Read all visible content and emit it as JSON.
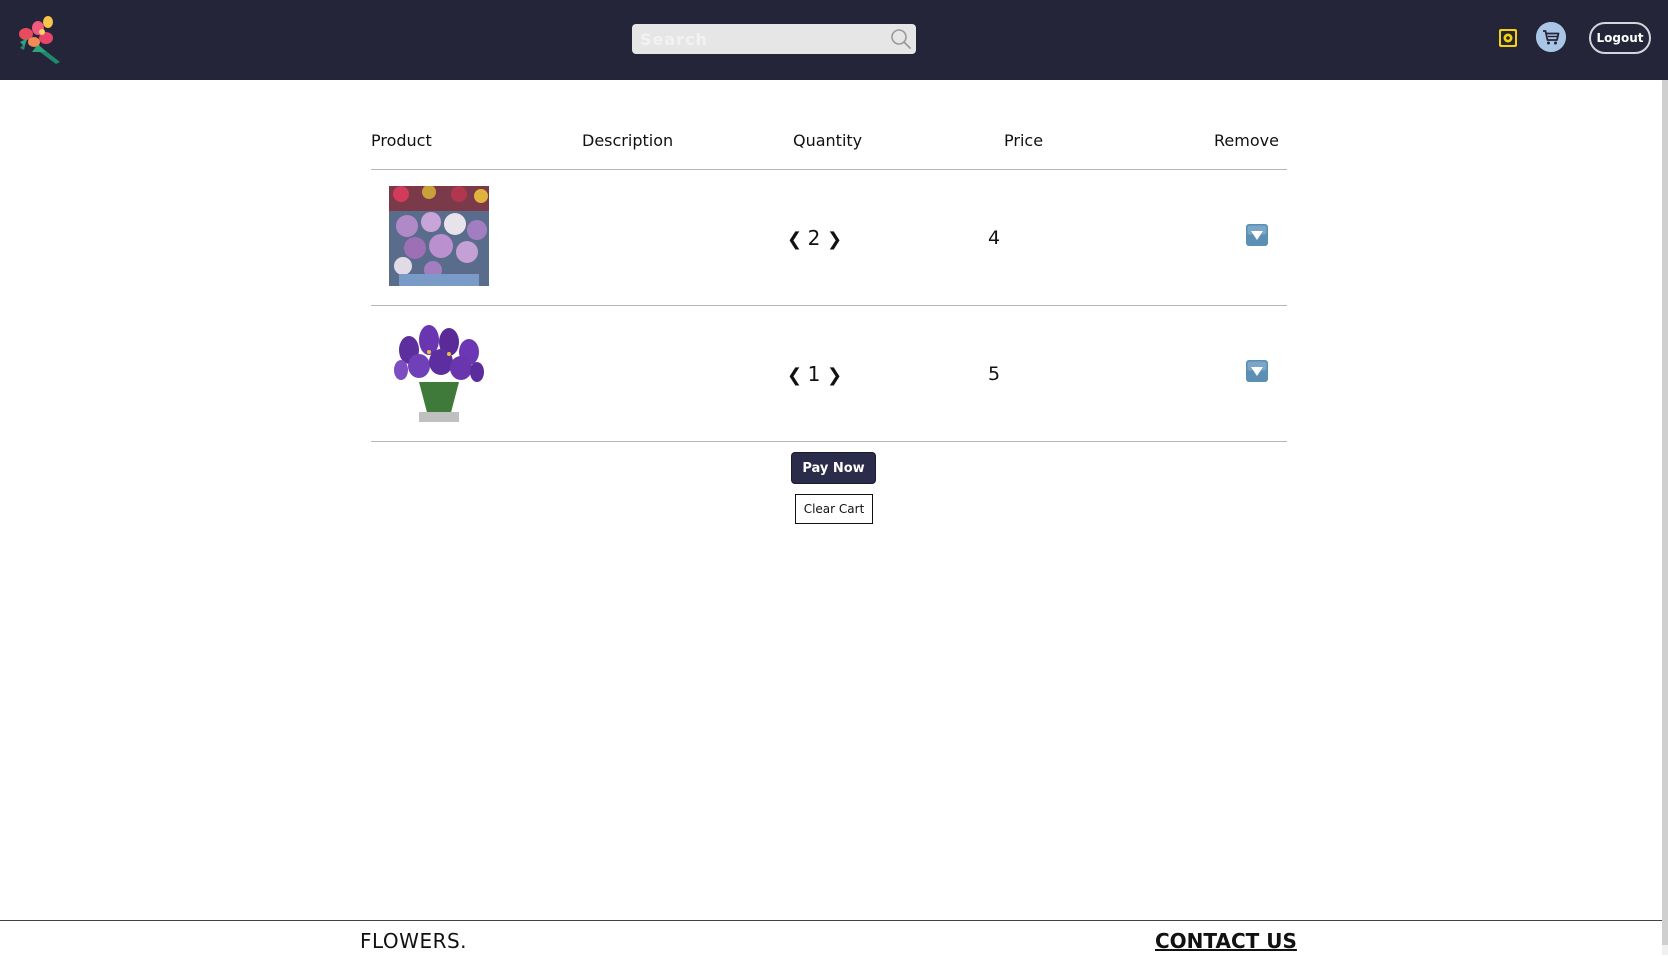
{
  "header": {
    "search": {
      "placeholder": "Search"
    },
    "logout_label": "Logout"
  },
  "cart": {
    "columns": {
      "product": "Product",
      "description": "Description",
      "quantity": "Quantity",
      "price": "Price",
      "remove": "Remove"
    },
    "items": [
      {
        "image": "purple-white-ornamental-cabbage-bouquet",
        "description": "",
        "quantity": "2",
        "price": "4"
      },
      {
        "image": "purple-iris-bouquet-vase",
        "description": "",
        "quantity": "1",
        "price": "5"
      }
    ],
    "qty_decrement": "❮",
    "qty_increment": "❯",
    "pay_label": "Pay Now",
    "clear_label": "Clear Cart"
  },
  "footer": {
    "brand": "FLOWERS.",
    "contact_label": "CONTACT US"
  },
  "colors": {
    "navbar_bg": "#25253a",
    "pay_button_bg": "#2b2b4a",
    "star_yellow": "#f4d20c",
    "cart_icon_bg": "#a9c6e6",
    "remove_icon_bg": "#5b8fb4"
  },
  "icons": [
    "logo-bouquet-icon",
    "search-icon",
    "star-icon",
    "cart-icon",
    "remove-icon"
  ]
}
